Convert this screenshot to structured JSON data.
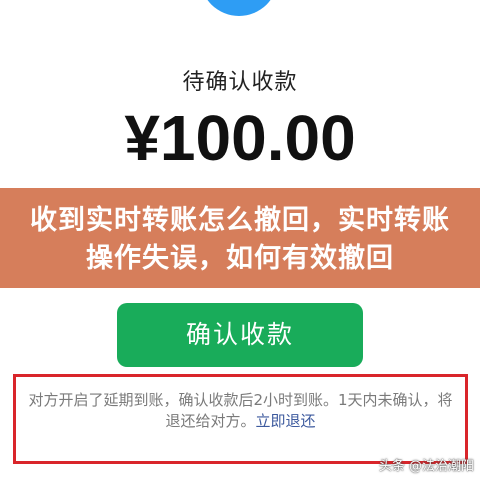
{
  "payment": {
    "status_label": "待确认收款",
    "amount": "¥100.00",
    "confirm_button_label": "确认收款"
  },
  "headline": {
    "text": "收到实时转账怎么撤回，实时转账操作失误，如何有效撤回"
  },
  "notice": {
    "text": "对方开启了延期到账，确认收款后2小时到账。1天内未确认，将退还给对方。",
    "link_label": "立即退还"
  },
  "watermark": {
    "text": "头条 @法治潮阳"
  },
  "colors": {
    "accent_green": "#19ac5a",
    "banner": "#d67e5b",
    "highlight_border": "#d9252a",
    "status_icon_blue": "#2e9df4"
  }
}
